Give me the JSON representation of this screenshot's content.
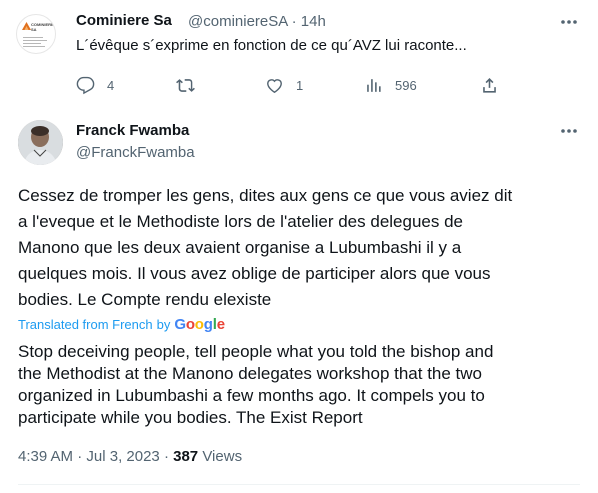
{
  "parent": {
    "avatar_logo_text": "COMINIERE SA",
    "name": "Cominiere Sa",
    "handle": "@cominiereSA",
    "separator": "·",
    "time": "14h",
    "text": "L´évêque s´exprime en fonction de ce qu´AVZ lui raconte...",
    "actions": {
      "replies": "4",
      "retweets": "",
      "likes": "1",
      "views": "596"
    }
  },
  "tweet": {
    "name": "Franck Fwamba",
    "handle": "@FranckFwamba",
    "body_lines": [
      "Cessez de tromper les gens, dites aux gens ce que vous aviez dit",
      "a l'eveque et le Methodiste lors de l'atelier des delegues de",
      "Manono que les deux avaient organise a Lubumbashi il y a",
      "quelques mois. Il vous avez oblige de participer alors que vous",
      "bodies. Le Compte rendu elexiste"
    ],
    "translated_label": "Translated from French",
    "translated_by": "by",
    "google_letters": [
      "G",
      "o",
      "o",
      "g",
      "l",
      "e"
    ],
    "translation_lines": [
      "Stop deceiving people, tell people what you told the bishop and",
      "the Methodist at the Manono delegates workshop that the two",
      "organized in Lubumbashi a few months ago. It compels you to",
      "participate while you bodies. The Exist Report"
    ],
    "time": "4:39 AM",
    "separator": "·",
    "date": "Jul 3, 2023",
    "separator2": "·",
    "views_count": "387",
    "views_label": "Views"
  },
  "colors": {
    "text": "#0f1419",
    "secondary": "#536471",
    "link": "#1d9bf0",
    "google_blue": "#4285F4",
    "google_red": "#EA4335",
    "google_yellow": "#FBBC05",
    "google_green": "#34A853"
  }
}
